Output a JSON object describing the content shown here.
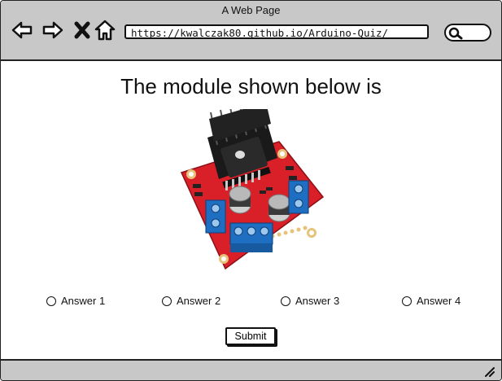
{
  "window": {
    "title": "A Web Page"
  },
  "browser": {
    "url": "https://kwalczak80.github.io/Arduino-Quiz/",
    "icons": [
      "back-arrow-icon",
      "forward-arrow-icon",
      "close-icon",
      "home-icon",
      "search-icon"
    ]
  },
  "quiz": {
    "question": "The module shown below is",
    "image": "l298n-motor-driver-module",
    "answers": [
      {
        "label": "Answer 1"
      },
      {
        "label": "Answer 2"
      },
      {
        "label": "Answer 3"
      },
      {
        "label": "Answer 4"
      }
    ],
    "submit_label": "Submit"
  },
  "colors": {
    "chrome": "#c8c8c8",
    "board": "#d92028",
    "terminal": "#1e6fc2",
    "heatsink": "#1a1a1a"
  }
}
